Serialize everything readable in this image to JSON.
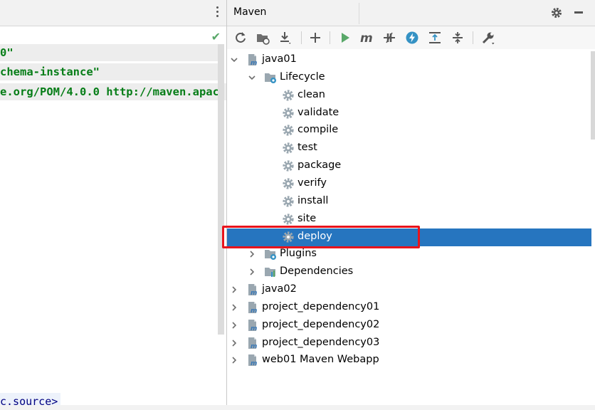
{
  "editor": {
    "lines": [
      "0\"",
      "chema-instance\"",
      "e.org/POM/4.0.0 http://maven.apac"
    ],
    "bottom_text": "c.source>"
  },
  "maven_panel": {
    "title": "Maven",
    "toolbar": [
      {
        "name": "reload-icon"
      },
      {
        "name": "generate-sources-icon"
      },
      {
        "name": "download-icon"
      },
      {
        "name": "add-icon"
      },
      {
        "name": "run-icon"
      },
      {
        "name": "execute-goal-icon"
      },
      {
        "name": "toggle-offline-icon"
      },
      {
        "name": "skip-tests-icon"
      },
      {
        "name": "show-dependencies-icon"
      },
      {
        "name": "collapse-all-icon"
      },
      {
        "name": "maven-settings-icon"
      }
    ],
    "tree": [
      {
        "label": "java01",
        "type": "project",
        "level": 0,
        "expanded": true
      },
      {
        "label": "Lifecycle",
        "type": "folder",
        "level": 1,
        "expanded": true
      },
      {
        "label": "clean",
        "type": "goal",
        "level": 2
      },
      {
        "label": "validate",
        "type": "goal",
        "level": 2
      },
      {
        "label": "compile",
        "type": "goal",
        "level": 2
      },
      {
        "label": "test",
        "type": "goal",
        "level": 2
      },
      {
        "label": "package",
        "type": "goal",
        "level": 2
      },
      {
        "label": "verify",
        "type": "goal",
        "level": 2
      },
      {
        "label": "install",
        "type": "goal",
        "level": 2
      },
      {
        "label": "site",
        "type": "goal",
        "level": 2
      },
      {
        "label": "deploy",
        "type": "goal",
        "level": 2,
        "selected": true
      },
      {
        "label": "Plugins",
        "type": "folder",
        "level": 1,
        "expanded": false
      },
      {
        "label": "Dependencies",
        "type": "deps",
        "level": 1,
        "expanded": false
      },
      {
        "label": "java02",
        "type": "project",
        "level": 0,
        "expanded": false
      },
      {
        "label": "project_dependency01",
        "type": "project",
        "level": 0,
        "expanded": false
      },
      {
        "label": "project_dependency02",
        "type": "project",
        "level": 0,
        "expanded": false
      },
      {
        "label": "project_dependency03",
        "type": "project",
        "level": 0,
        "expanded": false
      },
      {
        "label": "web01 Maven Webapp",
        "type": "project",
        "level": 0,
        "expanded": false
      }
    ]
  },
  "colors": {
    "selection": "#2675bf",
    "highlight_box": "#e8141c",
    "code_string": "#067d17"
  }
}
